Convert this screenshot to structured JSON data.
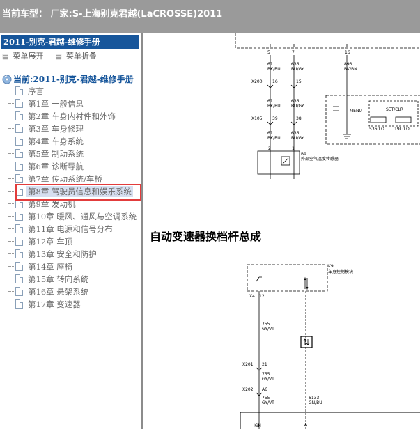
{
  "window": {
    "title": "当前车型： 厂家:S-上海别克君越(LaCROSSE)2011"
  },
  "sidebar": {
    "manual_title": "2011-别克-君越-维修手册",
    "expand_label": "菜单展开",
    "collapse_label": "菜单折叠",
    "root_label": "当前:2011-别克-君越-维修手册",
    "items": [
      {
        "label": "序言"
      },
      {
        "label": "第1章 一般信息"
      },
      {
        "label": "第2章 车身内衬件和外饰"
      },
      {
        "label": "第3章 车身修理"
      },
      {
        "label": "第4章 车身系统"
      },
      {
        "label": "第5章 制动系统"
      },
      {
        "label": "第6章 诊断导航"
      },
      {
        "label": "第7章 传动系统/车桥"
      },
      {
        "label": "第8章 驾驶员信息和娱乐系统"
      },
      {
        "label": "第9章 发动机"
      },
      {
        "label": "第10章 暖风、通风与空调系统"
      },
      {
        "label": "第11章 电源和信号分布"
      },
      {
        "label": "第12章 车顶"
      },
      {
        "label": "第13章 安全和防护"
      },
      {
        "label": "第14章 座椅"
      },
      {
        "label": "第15章 转向系统"
      },
      {
        "label": "第16章 悬架系统"
      },
      {
        "label": "第17章 变速器"
      }
    ],
    "selected_index": 8
  },
  "diagram": {
    "section_heading": "自动变速器换档杆总成",
    "upper": {
      "pins": [
        "5",
        "7",
        "16"
      ],
      "wires": [
        {
          "id": "61",
          "color": "BK/BU"
        },
        {
          "id": "636",
          "color": "BU/GY"
        },
        {
          "id": "893",
          "color": "BK/BN"
        }
      ],
      "x200": {
        "name": "X200",
        "pin_a": "16",
        "pin_b": "15"
      },
      "x105": {
        "name": "X105",
        "pin_a": "39",
        "pin_b": "38"
      },
      "sensor": {
        "pins": [
          "2",
          "1"
        ],
        "code": "B9",
        "name": "外部空气温度传感器"
      },
      "switch": {
        "menu": "MENU",
        "set": "SET/CLR",
        "r1": "5360 Ω",
        "r2": "1910 Ω"
      }
    },
    "lower": {
      "module": {
        "code": "K9",
        "name": "车身控制模块",
        "conn": "X4",
        "pin": "12"
      },
      "wire1": {
        "id": "755",
        "color": "GY/VT"
      },
      "x201": {
        "name": "X201",
        "pin": "21"
      },
      "x202": {
        "name": "X202",
        "pin": "A6"
      },
      "wire2": {
        "id": "6133",
        "color": "GN/BU"
      },
      "bottom_label": "IGN"
    }
  }
}
